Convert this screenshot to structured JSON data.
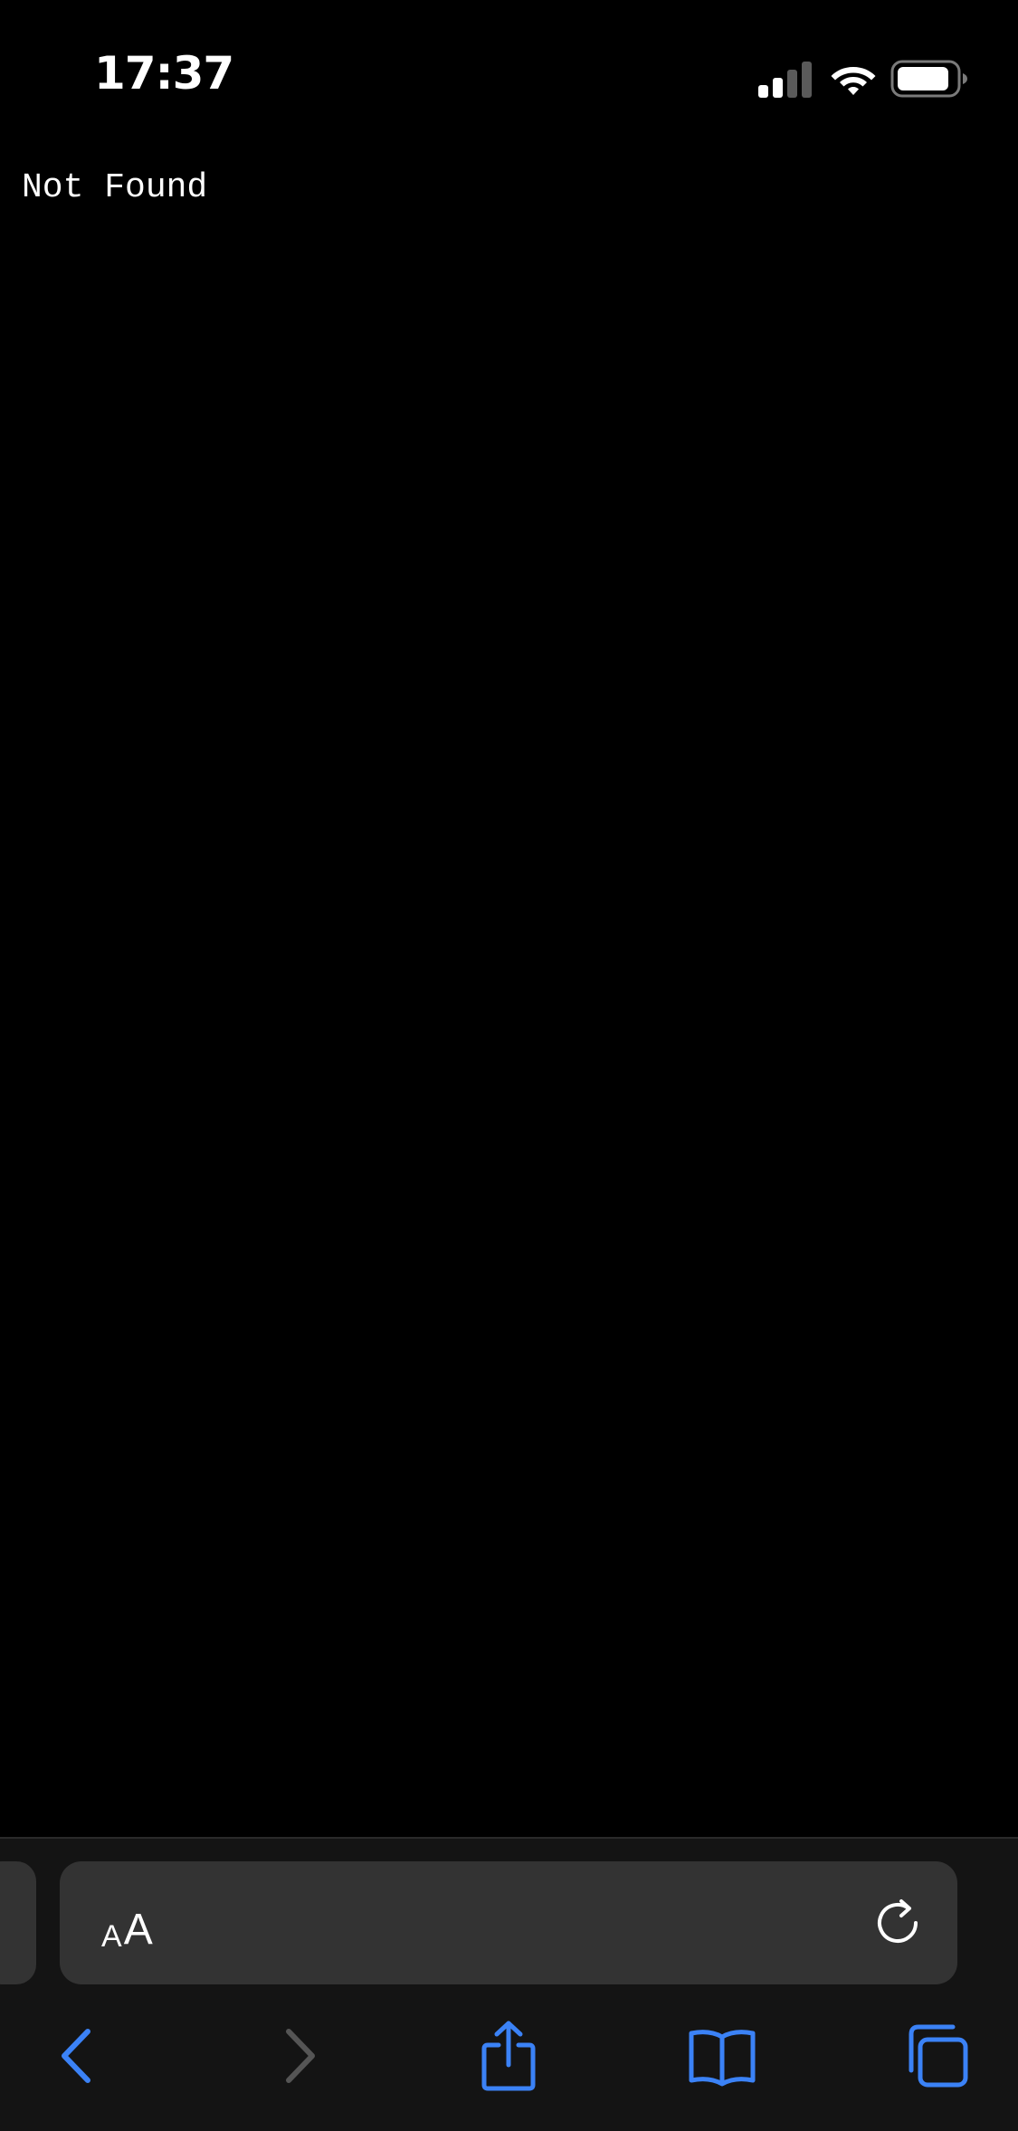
{
  "status_bar": {
    "time": "17:37",
    "icons": [
      "cellular-signal-icon",
      "wifi-icon",
      "battery-icon"
    ]
  },
  "page": {
    "text": "Not Found"
  },
  "browser": {
    "address_bar": {
      "text_size_label_small": "A",
      "text_size_label_large": "A",
      "reload_icon": "reload-icon"
    },
    "toolbar": {
      "buttons": [
        "back-icon",
        "forward-icon",
        "share-icon",
        "bookmarks-icon",
        "tabs-icon"
      ]
    }
  },
  "colors": {
    "background": "#000000",
    "toolbar_bg": "#141414",
    "address_bar_bg": "#333333",
    "accent": "#3b82f6",
    "disabled": "#555555",
    "text": "#ffffff"
  }
}
